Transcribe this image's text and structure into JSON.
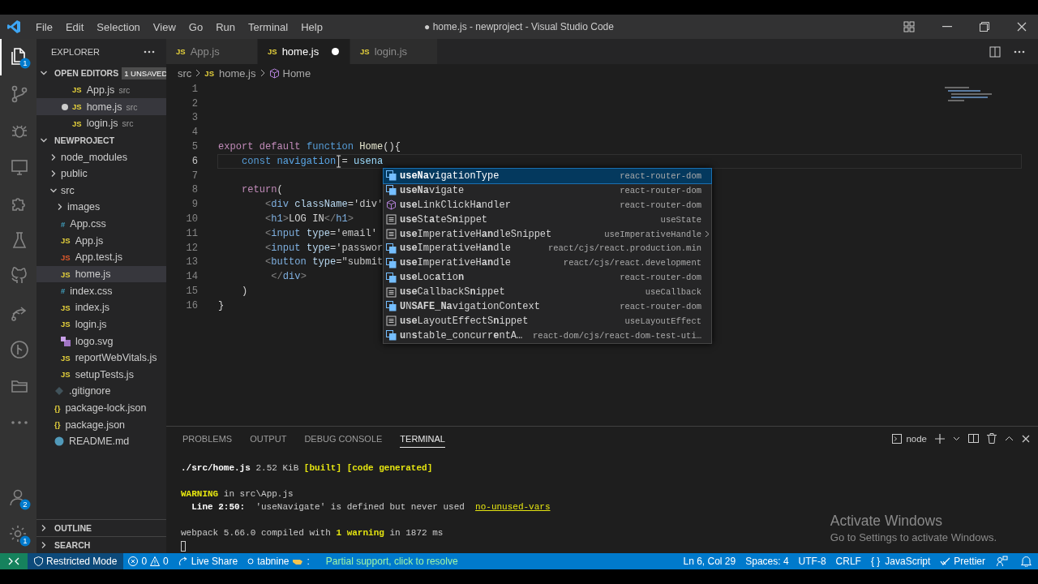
{
  "window": {
    "title": "● home.js - newproject - Visual Studio Code",
    "menu": [
      "File",
      "Edit",
      "Selection",
      "View",
      "Go",
      "Run",
      "Terminal",
      "Help"
    ]
  },
  "activity_bar": {
    "items": [
      {
        "kind": "files",
        "selected": true,
        "badge": "1"
      },
      {
        "kind": "source-control",
        "selected": false
      },
      {
        "kind": "debug",
        "selected": false
      },
      {
        "kind": "remote",
        "selected": false
      },
      {
        "kind": "extensions",
        "selected": false
      },
      {
        "kind": "testing",
        "selected": false
      },
      {
        "kind": "github",
        "selected": false
      },
      {
        "kind": "live-share",
        "selected": false
      },
      {
        "kind": "git-graph",
        "selected": false
      },
      {
        "kind": "folder",
        "selected": false
      },
      {
        "kind": "more",
        "selected": false
      }
    ],
    "bottom": [
      {
        "kind": "account",
        "badge": "2"
      },
      {
        "kind": "settings",
        "badge": "1"
      }
    ]
  },
  "sidebar": {
    "title": "EXPLORER",
    "open_editors": {
      "title": "OPEN EDITORS",
      "badge": "1 UNSAVED",
      "expanded": true,
      "items": [
        {
          "name": "App.js",
          "dir": "src",
          "glyph": "JS",
          "dirty": false,
          "selected": false
        },
        {
          "name": "home.js",
          "dir": "src",
          "glyph": "JS",
          "dirty": true,
          "selected": true
        },
        {
          "name": "login.js",
          "dir": "src",
          "glyph": "JS",
          "dirty": false,
          "selected": false
        }
      ]
    },
    "project": {
      "title": "NEWPROJECT",
      "expanded": true,
      "children": [
        {
          "name": "node_modules",
          "kind": "folder",
          "expanded": false,
          "selected": false
        },
        {
          "name": "public",
          "kind": "folder",
          "expanded": false,
          "selected": false
        },
        {
          "name": "src",
          "kind": "folder",
          "expanded": true,
          "selected": false,
          "children": [
            {
              "name": "images",
              "kind": "folder",
              "expanded": false,
              "selected": false
            },
            {
              "name": "App.css",
              "kind": "css",
              "glyph": "#",
              "selected": false
            },
            {
              "name": "App.js",
              "kind": "js",
              "glyph": "JS",
              "selected": false
            },
            {
              "name": "App.test.js",
              "kind": "test",
              "glyph": "JS",
              "selected": false
            },
            {
              "name": "home.js",
              "kind": "js",
              "glyph": "JS",
              "selected": true
            },
            {
              "name": "index.css",
              "kind": "css",
              "glyph": "#",
              "selected": false
            },
            {
              "name": "index.js",
              "kind": "js",
              "glyph": "JS",
              "selected": false
            },
            {
              "name": "login.js",
              "kind": "js",
              "glyph": "JS",
              "selected": false
            },
            {
              "name": "logo.svg",
              "kind": "svg",
              "selected": false
            },
            {
              "name": "reportWebVitals.js",
              "kind": "js",
              "glyph": "JS",
              "selected": false
            },
            {
              "name": "setupTests.js",
              "kind": "js",
              "glyph": "JS",
              "selected": false
            }
          ]
        },
        {
          "name": ".gitignore",
          "kind": "git",
          "selected": false
        },
        {
          "name": "package-lock.json",
          "kind": "json",
          "glyph": "{}",
          "selected": false
        },
        {
          "name": "package.json",
          "kind": "json",
          "glyph": "{}",
          "selected": false
        },
        {
          "name": "README.md",
          "kind": "readme",
          "selected": false
        }
      ]
    },
    "sections": [
      {
        "title": "OUTLINE",
        "expanded": false
      },
      {
        "title": "SEARCH",
        "expanded": false
      }
    ]
  },
  "tabs": [
    {
      "label": "App.js",
      "glyph": "JS",
      "selected": false,
      "dirty": false
    },
    {
      "label": "home.js",
      "glyph": "JS",
      "selected": true,
      "dirty": true
    },
    {
      "label": "login.js",
      "glyph": "JS",
      "selected": false,
      "dirty": false
    }
  ],
  "breadcrumbs": [
    {
      "kind": "folder",
      "text": "src"
    },
    {
      "kind": "file",
      "glyph": "JS",
      "text": "home.js"
    },
    {
      "kind": "symbol",
      "text": "Home"
    }
  ],
  "code": [
    {
      "number": "1",
      "current": false
    },
    {
      "number": "2",
      "current": false
    },
    {
      "number": "3",
      "current": false
    },
    {
      "number": "4",
      "current": false
    },
    {
      "number": "5",
      "current": false,
      "tokens": [
        {
          "t": "export ",
          "kind": "keyword"
        },
        {
          "t": "default ",
          "kind": "keyword"
        },
        {
          "t": "function ",
          "kind": "storage"
        },
        {
          "t": "Home",
          "kind": "func"
        },
        {
          "t": "(){",
          "kind": "plain"
        }
      ]
    },
    {
      "number": "6",
      "current": true,
      "tokens": [
        {
          "t": "    const ",
          "kind": "storage"
        },
        {
          "t": "navigation",
          "kind": "const"
        },
        {
          "kind": "ibeam"
        },
        {
          "t": "= ",
          "kind": "plain"
        },
        {
          "t": "usena",
          "kind": "var"
        }
      ]
    },
    {
      "number": "7",
      "current": false
    },
    {
      "number": "8",
      "current": false,
      "tokens": [
        {
          "t": "    return",
          "kind": "keyword"
        },
        {
          "t": "(",
          "kind": "plain"
        }
      ]
    },
    {
      "number": "9",
      "current": false,
      "tokens": [
        {
          "t": "        <",
          "kind": "punct"
        },
        {
          "t": "div ",
          "kind": "tag"
        },
        {
          "t": "className",
          "kind": "attr"
        },
        {
          "t": "=",
          "kind": "plain"
        },
        {
          "t": "'div'",
          "kind": "string"
        }
      ]
    },
    {
      "number": "10",
      "current": false,
      "tokens": [
        {
          "t": "        <",
          "kind": "punct"
        },
        {
          "t": "h1",
          "kind": "tag"
        },
        {
          "t": ">",
          "kind": "punct"
        },
        {
          "t": "LOG IN",
          "kind": "plain"
        },
        {
          "t": "</",
          "kind": "punct"
        },
        {
          "t": "h1",
          "kind": "tag"
        },
        {
          "t": ">",
          "kind": "punct"
        }
      ]
    },
    {
      "number": "11",
      "current": false,
      "tokens": [
        {
          "t": "        <",
          "kind": "punct"
        },
        {
          "t": "input ",
          "kind": "tag"
        },
        {
          "t": "type",
          "kind": "attr"
        },
        {
          "t": "=",
          "kind": "plain"
        },
        {
          "t": "'email'",
          "kind": "string"
        }
      ]
    },
    {
      "number": "12",
      "current": false,
      "tokens": [
        {
          "t": "        <",
          "kind": "punct"
        },
        {
          "t": "input ",
          "kind": "tag"
        },
        {
          "t": "type",
          "kind": "attr"
        },
        {
          "t": "=",
          "kind": "plain"
        },
        {
          "t": "'passwor",
          "kind": "string"
        }
      ]
    },
    {
      "number": "13",
      "current": false,
      "tokens": [
        {
          "t": "        <",
          "kind": "punct"
        },
        {
          "t": "button ",
          "kind": "tag"
        },
        {
          "t": "type",
          "kind": "attr"
        },
        {
          "t": "=",
          "kind": "plain"
        },
        {
          "t": "\"submit",
          "kind": "string"
        }
      ]
    },
    {
      "number": "14",
      "current": false,
      "tokens": [
        {
          "t": "         </",
          "kind": "punct"
        },
        {
          "t": "div",
          "kind": "tag"
        },
        {
          "t": ">",
          "kind": "punct"
        }
      ]
    },
    {
      "number": "15",
      "current": false,
      "tokens": [
        {
          "t": "    )",
          "kind": "plain"
        }
      ]
    },
    {
      "number": "16",
      "current": false,
      "tokens": [
        {
          "t": "}",
          "kind": "plain"
        }
      ]
    }
  ],
  "suggestions": [
    {
      "label": "**useNa**vigationType",
      "detail": "react-router-dom",
      "kind": "reference",
      "selected": true,
      "more": false
    },
    {
      "label": "**useNa**vigate",
      "detail": "react-router-dom",
      "kind": "reference",
      "selected": false,
      "more": false
    },
    {
      "label": "**use**LinkClickH**a**ndler",
      "detail": "react-router-dom",
      "kind": "module",
      "selected": false,
      "more": false
    },
    {
      "label": "**use**St**a**teS**n**ippet",
      "detail": "useState",
      "kind": "snippet",
      "selected": false,
      "more": false
    },
    {
      "label": "**use**ImperativeH**an**dleSnippet",
      "detail": "useImperativeHandle",
      "kind": "snippet",
      "selected": false,
      "more": true
    },
    {
      "label": "**use**ImperativeH**an**dle",
      "detail": "react/cjs/react.production.min",
      "kind": "reference",
      "selected": false,
      "more": false
    },
    {
      "label": "**use**ImperativeH**an**dle",
      "detail": "react/cjs/react.development",
      "kind": "reference",
      "selected": false,
      "more": false
    },
    {
      "label": "**use**Loc**a**tio**n**",
      "detail": "react-router-dom",
      "kind": "reference",
      "selected": false,
      "more": false
    },
    {
      "label": "**use**CallbackS**n**ippet",
      "detail": "useCallback",
      "kind": "snippet",
      "selected": false,
      "more": false
    },
    {
      "label": "**U**N**SAFE**_**Na**vigationContext",
      "detail": "react-router-dom",
      "kind": "reference",
      "selected": false,
      "more": false
    },
    {
      "label": "**use**LayoutEffectS**n**ippet",
      "detail": "useLayoutEffect",
      "kind": "snippet",
      "selected": false,
      "more": false
    },
    {
      "label": "**u**n**s**table_concurr**e**ntA…",
      "detail": "react-dom/cjs/react-dom-test-uti…",
      "kind": "reference",
      "selected": false,
      "more": false
    }
  ],
  "panel": {
    "tabs": [
      {
        "label": "PROBLEMS",
        "selected": false
      },
      {
        "label": "OUTPUT",
        "selected": false
      },
      {
        "label": "DEBUG CONSOLE",
        "selected": false
      },
      {
        "label": "TERMINAL",
        "selected": true
      }
    ],
    "terminal_name": "node",
    "lines": [
      {
        "gap_before": false,
        "segments": [
          {
            "t": "./src/home.js",
            "kind": "bold"
          },
          {
            "t": " 2.52 KiB ",
            "kind": "plain"
          },
          {
            "t": "[built] [code generated]",
            "kind": "hl"
          }
        ]
      },
      {
        "gap_before": true,
        "segments": [
          {
            "t": "WARNING",
            "kind": "hl"
          },
          {
            "t": " in src\\App.js",
            "kind": "plain"
          }
        ]
      },
      {
        "gap_before": false,
        "segments": [
          {
            "t": "  Line 2:50:",
            "kind": "bold"
          },
          {
            "t": "  'useNavigate' is defined but never used  ",
            "kind": "plain"
          },
          {
            "t": "no-unused-vars",
            "kind": "link"
          }
        ]
      },
      {
        "gap_before": true,
        "segments": [
          {
            "t": "webpack 5.66.0 compiled with ",
            "kind": "plain"
          },
          {
            "t": "1 warning",
            "kind": "hl"
          },
          {
            "t": " in 1872 ms",
            "kind": "plain"
          }
        ]
      }
    ],
    "cursor": true
  },
  "activation": {
    "title": "Activate Windows",
    "subtitle": "Go to Settings to activate Windows."
  },
  "status_bar": {
    "left": [
      {
        "kind": "remote"
      },
      {
        "kind": "restricted",
        "text": "Restricted Mode"
      },
      {
        "kind": "problems",
        "errors": "0",
        "warnings": "0"
      },
      {
        "kind": "liveshare",
        "text": "Live Share"
      },
      {
        "kind": "tabnine",
        "text": "tabnine",
        "suffix": ":"
      },
      {
        "kind": "message",
        "text": "Partial support, click to resolve"
      }
    ],
    "right": [
      {
        "kind": "text",
        "text": "Ln 6, Col 29"
      },
      {
        "kind": "text",
        "text": "Spaces: 4"
      },
      {
        "kind": "text",
        "text": "UTF-8"
      },
      {
        "kind": "text",
        "text": "CRLF"
      },
      {
        "kind": "language",
        "glyph": "{ }",
        "text": "JavaScript"
      },
      {
        "kind": "prettier",
        "text": "Prettier"
      },
      {
        "kind": "feedback"
      },
      {
        "kind": "bell"
      }
    ]
  }
}
